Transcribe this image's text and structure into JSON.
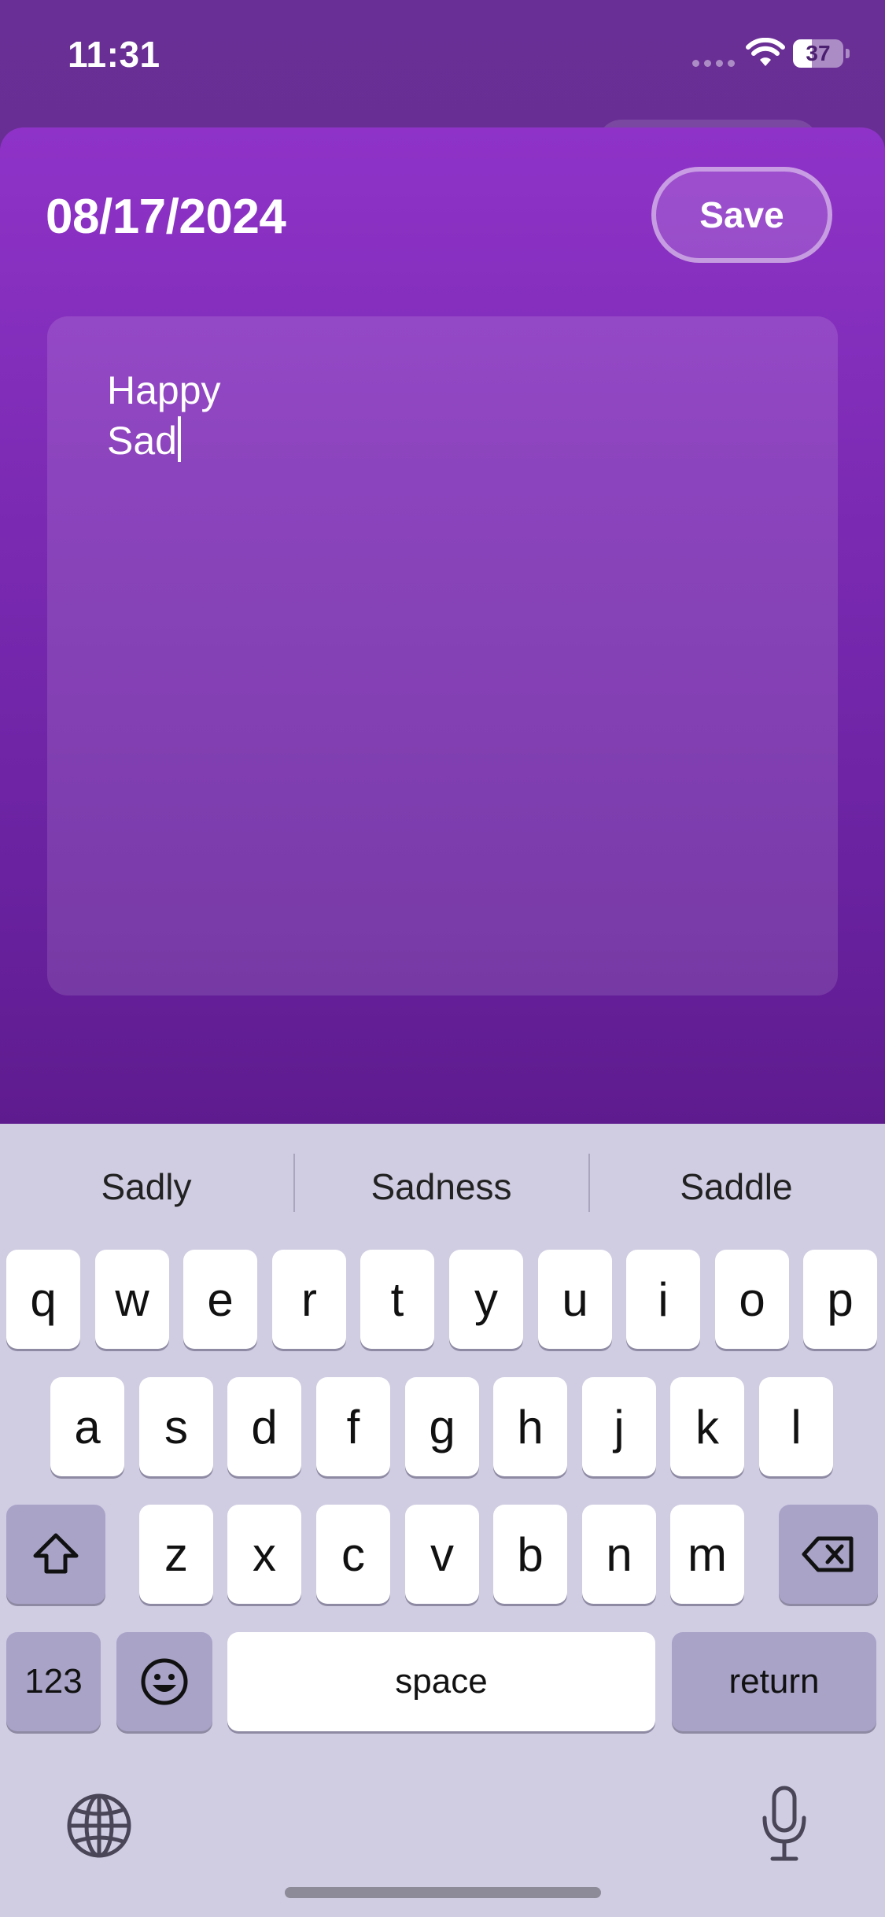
{
  "status_bar": {
    "time": "11:31",
    "battery_level": "37",
    "battery_fraction": 0.37
  },
  "header": {
    "date": "08/17/2024",
    "save_label": "Save"
  },
  "editor": {
    "lines": [
      "Happy",
      "Sad"
    ]
  },
  "keyboard": {
    "suggestions": [
      "Sadly",
      "Sadness",
      "Saddle"
    ],
    "row1": [
      "q",
      "w",
      "e",
      "r",
      "t",
      "y",
      "u",
      "i",
      "o",
      "p"
    ],
    "row2": [
      "a",
      "s",
      "d",
      "f",
      "g",
      "h",
      "j",
      "k",
      "l"
    ],
    "row3": [
      "z",
      "x",
      "c",
      "v",
      "b",
      "n",
      "m"
    ],
    "numbers_label": "123",
    "space_label": "space",
    "return_label": "return"
  },
  "icons": {
    "wifi": "wifi-icon",
    "shift": "shift-icon",
    "delete": "delete-icon",
    "emoji": "emoji-icon",
    "globe": "globe-icon",
    "mic": "mic-icon"
  },
  "colors": {
    "sheet_top": "#8f33c8",
    "sheet_bottom": "#5e1b8e",
    "keyboard_bg": "#d0cce2",
    "func_key": "#a9a3c8"
  }
}
